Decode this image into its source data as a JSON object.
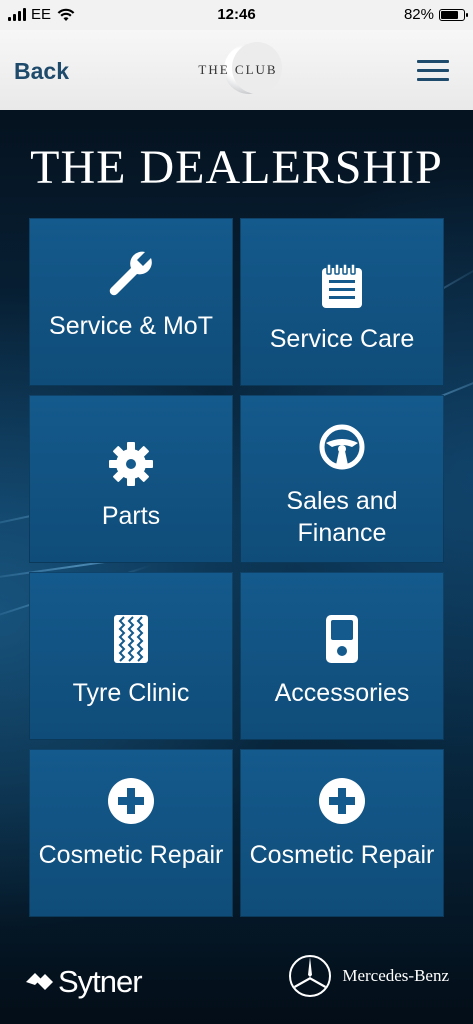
{
  "status_bar": {
    "carrier": "EE",
    "time": "12:46",
    "battery": "82%",
    "battery_level": 0.82
  },
  "nav": {
    "back_label": "Back",
    "logo_text": "THE CLUB",
    "menu_icon": "hamburger-icon"
  },
  "page": {
    "title": "THE DEALERSHIP"
  },
  "tiles": [
    {
      "label": "Service & MoT",
      "icon": "wrench-icon"
    },
    {
      "label": "Service Care",
      "icon": "notepad-icon"
    },
    {
      "label": "Parts",
      "icon": "gear-icon"
    },
    {
      "label": "Sales and Finance",
      "icon": "steering-wheel-icon"
    },
    {
      "label": "Tyre Clinic",
      "icon": "tyre-tread-icon"
    },
    {
      "label": "Accessories",
      "icon": "ipod-icon"
    },
    {
      "label": "Cosmetic Repair",
      "icon": "plus-circle-icon"
    },
    {
      "label": "Cosmetic Repair",
      "icon": "plus-circle-icon"
    }
  ],
  "footer": {
    "left_brand": "Sytner",
    "right_brand": "Mercedes-Benz"
  },
  "colors": {
    "tile": "#145a8c",
    "nav_text": "#1e4a6c",
    "background": "#0a2f4c"
  }
}
